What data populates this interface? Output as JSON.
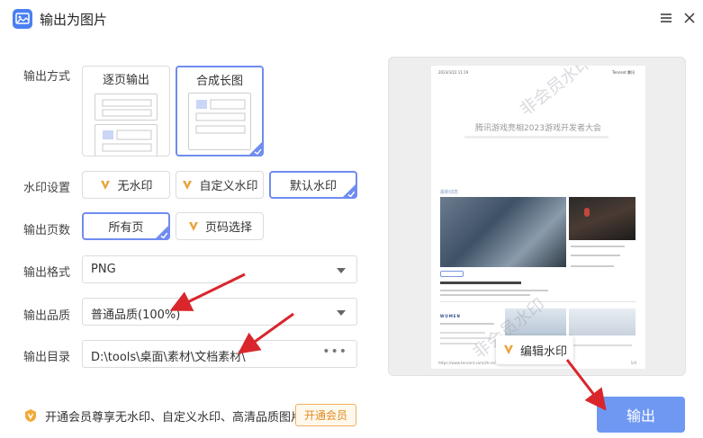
{
  "window": {
    "title": "输出为图片",
    "icons": {
      "app": "image-icon",
      "menu": "hamburger-menu-icon",
      "close": "close-icon"
    }
  },
  "output_mode": {
    "label": "输出方式",
    "options": [
      {
        "label": "逐页输出",
        "selected": false
      },
      {
        "label": "合成长图",
        "selected": true
      }
    ]
  },
  "watermark": {
    "label": "水印设置",
    "options": [
      {
        "label": "无水印",
        "vip": true,
        "selected": false
      },
      {
        "label": "自定义水印",
        "vip": true,
        "selected": false
      },
      {
        "label": "默认水印",
        "vip": false,
        "selected": true
      }
    ]
  },
  "pages": {
    "label": "输出页数",
    "options": [
      {
        "label": "所有页",
        "vip": false,
        "selected": true
      },
      {
        "label": "页码选择",
        "vip": true,
        "selected": false
      }
    ]
  },
  "format": {
    "label": "输出格式",
    "value": "PNG"
  },
  "quality": {
    "label": "输出品质",
    "value": "普通品质(100%)"
  },
  "directory": {
    "label": "输出目录",
    "value": "D:\\tools\\桌面\\素材\\文档素材\\",
    "more": "•••"
  },
  "preview": {
    "edit_watermark_label": "编辑水印",
    "paper": {
      "header_left": "2023/3/22 11:19",
      "header_right": "Tencent 腾讯",
      "title": "腾讯游戏亮相2023游戏开发者大会",
      "section": "最新动态",
      "section_b": "WOMEN",
      "footer_left": "https://www.tencent.com/zh-cn/",
      "footer_right": "1/4",
      "watermark_text": "非会员水印"
    }
  },
  "promo": {
    "text": "开通会员尊享无水印、自定义水印、高清品质图片",
    "button": "开通会员",
    "icon": "vip-shield-icon"
  },
  "export_button": "输出",
  "colors": {
    "accent": "#6f8cf0",
    "primary_button": "#6f98f3",
    "vip_orange": "#e8a33d",
    "annotation_arrow": "#d9262c"
  }
}
